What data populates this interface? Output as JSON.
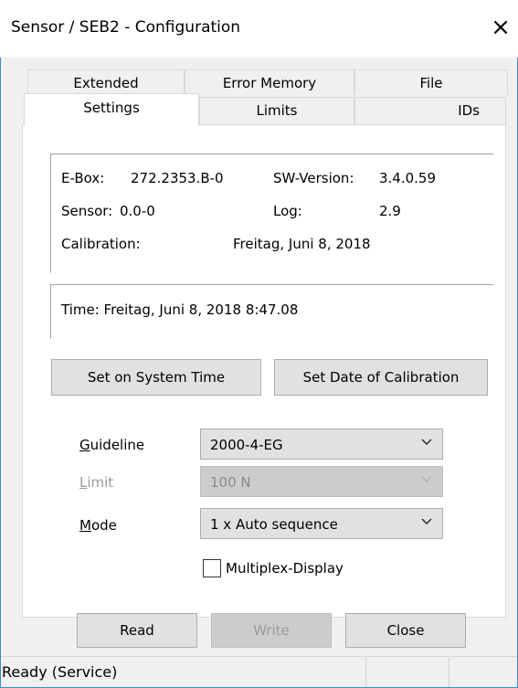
{
  "window": {
    "title": "Sensor / SEB2 - Configuration"
  },
  "tabs": {
    "row1": [
      {
        "label": "Extended"
      },
      {
        "label": "Error Memory"
      },
      {
        "label": "File"
      }
    ],
    "row2": [
      {
        "label": "Settings",
        "active": true
      },
      {
        "label": "Limits"
      },
      {
        "label": "IDs"
      }
    ]
  },
  "info": {
    "ebox_label": "E-Box:",
    "ebox_value": "272.2353.B-0",
    "sw_label": "SW-Version:",
    "sw_value": "3.4.0.59",
    "sensor_label": "Sensor:",
    "sensor_value": "0.0-0",
    "log_label": "Log:",
    "log_value": "2.9",
    "calibration_label": "Calibration:",
    "calibration_value": "Freitag, Juni 8, 2018"
  },
  "time": {
    "text": "Time: Freitag, Juni 8, 2018 8:47.08"
  },
  "buttons": {
    "set_system_time": "Set on System Time",
    "set_calibration_date": "Set Date of Calibration",
    "read": "Read",
    "write": "Write",
    "close": "Close"
  },
  "fields": {
    "guideline": {
      "label_first": "G",
      "label_rest": "uideline",
      "value": "2000-4-EG"
    },
    "limit": {
      "label_first": "L",
      "label_rest": "imit",
      "value": "100 N",
      "disabled": true
    },
    "mode": {
      "label_first": "M",
      "label_rest": "ode",
      "value": "1 x Auto sequence"
    }
  },
  "checkbox": {
    "label": "Multiplex-Display",
    "checked": false
  },
  "status": {
    "text": "Ready (Service)"
  },
  "icons": {
    "close": "close-icon",
    "dropdown": "chevron-down-icon"
  }
}
